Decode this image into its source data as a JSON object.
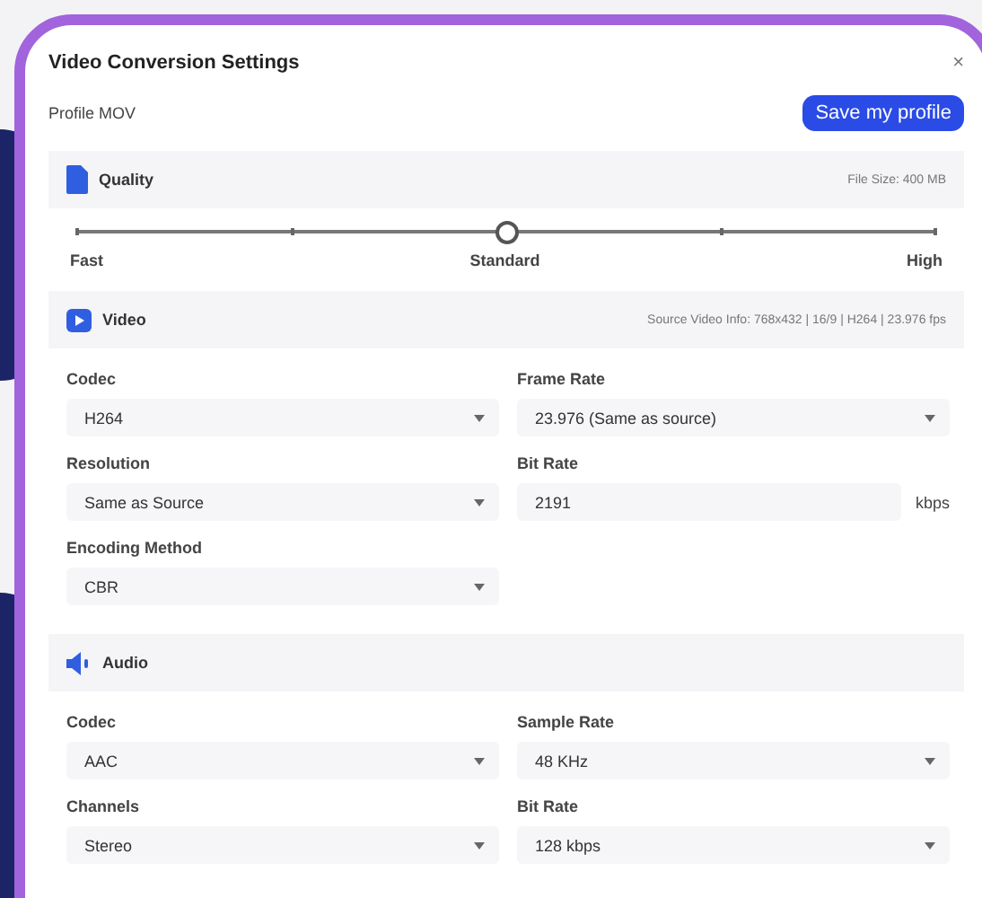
{
  "dialog": {
    "title": "Video Conversion Settings",
    "close": "×",
    "profile": "Profile MOV",
    "save_button": "Save my profile"
  },
  "sections": [
    {
      "kind": "quality",
      "title": "Quality",
      "info": "File Size: 400 MB",
      "slider": {
        "level": 0.5,
        "labels": [
          "Fast",
          "Standard",
          "High"
        ]
      }
    },
    {
      "kind": "video",
      "title": "Video",
      "info": "Source Video Info: 768x432 | 16/9 | H264 | 23.976 fps",
      "fields": [
        {
          "kind": "select",
          "label": "Codec",
          "value": "H264"
        },
        {
          "kind": "select",
          "label": "Frame Rate",
          "value": "23.976 (Same as source)"
        },
        {
          "kind": "select",
          "label": "Resolution",
          "value": "Same as Source"
        },
        {
          "kind": "input",
          "label": "Bit Rate",
          "value": "2191",
          "unit": "kbps"
        },
        {
          "kind": "select",
          "label": "Encoding Method",
          "value": "CBR"
        }
      ]
    },
    {
      "kind": "audio",
      "title": "Audio",
      "fields": [
        {
          "kind": "select",
          "label": "Codec",
          "value": "AAC"
        },
        {
          "kind": "select",
          "label": "Sample Rate",
          "value": "48 KHz"
        },
        {
          "kind": "select",
          "label": "Channels",
          "value": "Stereo"
        },
        {
          "kind": "select",
          "label": "Bit Rate",
          "value": "128 kbps"
        }
      ]
    }
  ]
}
